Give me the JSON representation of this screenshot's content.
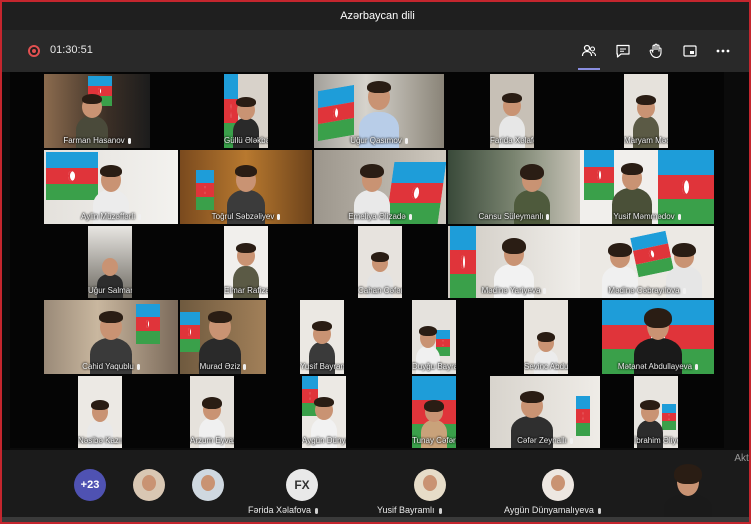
{
  "window": {
    "title": "Azərbaycan dili"
  },
  "toolbar": {
    "timer": "01:30:51",
    "icons": [
      "participants-icon",
      "chat-icon",
      "raise-hand-icon",
      "share-tray-icon",
      "more-options-icon"
    ],
    "accent": "#8a8ee0"
  },
  "grid": {
    "tiles": [
      {
        "name": "Farman Hasanov"
      },
      {
        "name": "Güllü Ələkbərova"
      },
      {
        "name": "Uğur Qasımov"
      },
      {
        "name": "Farida Xəlafova"
      },
      {
        "name": "Maryam Məcidova"
      },
      {
        "name": "Aylin Müzəffərli"
      },
      {
        "name": "Toğrul Səbzəliyev"
      },
      {
        "name": "Emeliya Əlizadə"
      },
      {
        "name": "Cansu Süleymanlı"
      },
      {
        "name": "Yusif Məmmədov"
      },
      {
        "name": "Uğur Salmanov"
      },
      {
        "name": "Elmar Rafizadə"
      },
      {
        "name": "Cahan Cəfərova"
      },
      {
        "name": "Mədinə Yariyeva"
      },
      {
        "name": "Mədinə Cəbrayılova"
      },
      {
        "name": "Cahid Yaqublu"
      },
      {
        "name": "Murad Əziz"
      },
      {
        "name": "Yusif Bayramlı"
      },
      {
        "name": "Duyğu Bayramlı"
      },
      {
        "name": "Sevinc Abdullayeva"
      },
      {
        "name": "Mətanət Abdullayeva"
      },
      {
        "name": "Nəsibə Kazımova"
      },
      {
        "name": "Arzum Eyvazlı"
      },
      {
        "name": "Aygün Dünyamalıyeva"
      },
      {
        "name": "Tunay Cəfərli"
      },
      {
        "name": "Cəfər Zeynallı"
      },
      {
        "name": "İbrahim Əliyev"
      }
    ]
  },
  "bottom": {
    "more_count": "+23",
    "participants": [
      {
        "name": "Fərida Xəlafova",
        "initials": "FX"
      },
      {
        "name": "Yusif Bayramlı"
      },
      {
        "name": "Aygün Dünyamalıyeva"
      }
    ],
    "pinned_watermark": "Akti"
  },
  "colors": {
    "border": "#c4262e",
    "flag_blue": "#1e9dd9",
    "flag_red": "#e0343a",
    "flag_green": "#3aa04a"
  }
}
